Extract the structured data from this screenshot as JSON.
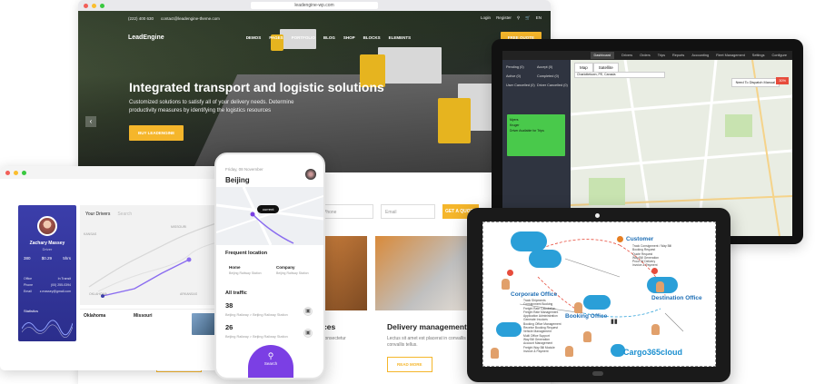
{
  "main_site": {
    "url": "leadengine-wp.com",
    "phone": "(222) 400 630",
    "email": "contact@leadengine-theme.com",
    "login": "Login",
    "register": "Register",
    "lang": "EN",
    "logo": "LeadEngine",
    "nav": [
      "DEMOS",
      "PAGES",
      "PORTFOLIO",
      "BLOG",
      "SHOP",
      "BLOCKS",
      "ELEMENTS"
    ],
    "cta": "FREE QUOTE",
    "hero_title": "Integrated transport and logistic solutions",
    "hero_sub": "Customized solutions to satisfy all of your delivery needs. Determine productivity measures by identifying the logistics resources",
    "hero_button": "BUY LEADENGINE",
    "form_phone": "Phone",
    "form_email": "Email",
    "form_button": "GET A QUOTE",
    "card1_title": "ces",
    "card1_text": "consectetur",
    "card2_title": "Delivery management",
    "card2_text": "Lectus sit amet est placerat in convallis convallis tellus.",
    "read_more": "READ MORE"
  },
  "driver_dash": {
    "tab": "Your Drivers",
    "search_placeholder": "Search",
    "name": "Zachary Massey",
    "role": "Driver",
    "stats": [
      {
        "v": "380",
        "l": "Rides"
      },
      {
        "v": "$0.29",
        "l": "Rate"
      },
      {
        "v": "5hrs",
        "l": "Time"
      }
    ],
    "info": [
      [
        "Office",
        "In Transit"
      ],
      [
        "Phone",
        "(00) 255-0394"
      ],
      [
        "Email",
        "z.massey@gmail.com"
      ]
    ],
    "statistics": "Statistics",
    "map_labels": [
      "KANSAS",
      "MISSOURI",
      "OKLAHOMA",
      "ARKANSAS"
    ],
    "card1_city": "Oklahoma",
    "card2_city": "Missouri"
  },
  "phone_app": {
    "date": "Friday, 08 November",
    "city": "Beijing",
    "current": "current",
    "frequent": "Frequent location",
    "home": "Home",
    "home_sub": "Beijing Railway Station",
    "company": "Company",
    "company_sub": "Beijing Railway Station",
    "all_traffic": "All traffic",
    "t1_num": "38",
    "t1_route": "Beijing Railway > Beijing Railway Station",
    "t2_num": "26",
    "t2_route": "Beijing Railway > Beijing Railway Station",
    "search": "Search"
  },
  "dispatch": {
    "nav": [
      "Dashboard",
      "Drivers",
      "Orders",
      "Trips",
      "Reports",
      "Accounting",
      "Fleet Management",
      "Settings",
      "Configure"
    ],
    "statuses": [
      "Pending (0)",
      "Accept (0)",
      "Active (0)",
      "Completed (0)",
      "User Cancelled (0)",
      "Driver Cancelled (0)"
    ],
    "green_rows": [
      "Myers",
      "Kruger"
    ],
    "green_note": "Driver Available for Trips",
    "map_tab": "Map",
    "sat_tab": "Satellite",
    "address": "Charlottetown, PE, Canada",
    "note": "Need To Dispatch Manual",
    "red": "30%"
  },
  "cargo": {
    "customer": "Customer",
    "corporate": "Corporate Office",
    "destination": "Destination Office",
    "booking": "Booking Office",
    "brand": "Cargo365cloud",
    "features": [
      "Track Consignment / Way Bill",
      "Booking Request",
      "Quote Request",
      "Way Bill Generation",
      "Proof Of Delivery",
      "Invoice & Payment"
    ],
    "corp_features": [
      "Track Shipments",
      "Consignment Booking",
      "Freight Rate Calculation",
      "Freight Rate Management",
      "Application Administration",
      "Generate Invoices",
      "Booking Office Management",
      "Receive Booking Request",
      "Vehicle Management",
      "Multi Office Support",
      "Way Bill Generation",
      "Account Management",
      "Freight Way Bill Module",
      "Invoice & Payment"
    ]
  },
  "colors": {
    "accent": "#f5b62b",
    "purple": "#7b3fe4",
    "navy": "#3b3eaa",
    "green": "#49c94b",
    "cloud": "#2a9fd8"
  }
}
